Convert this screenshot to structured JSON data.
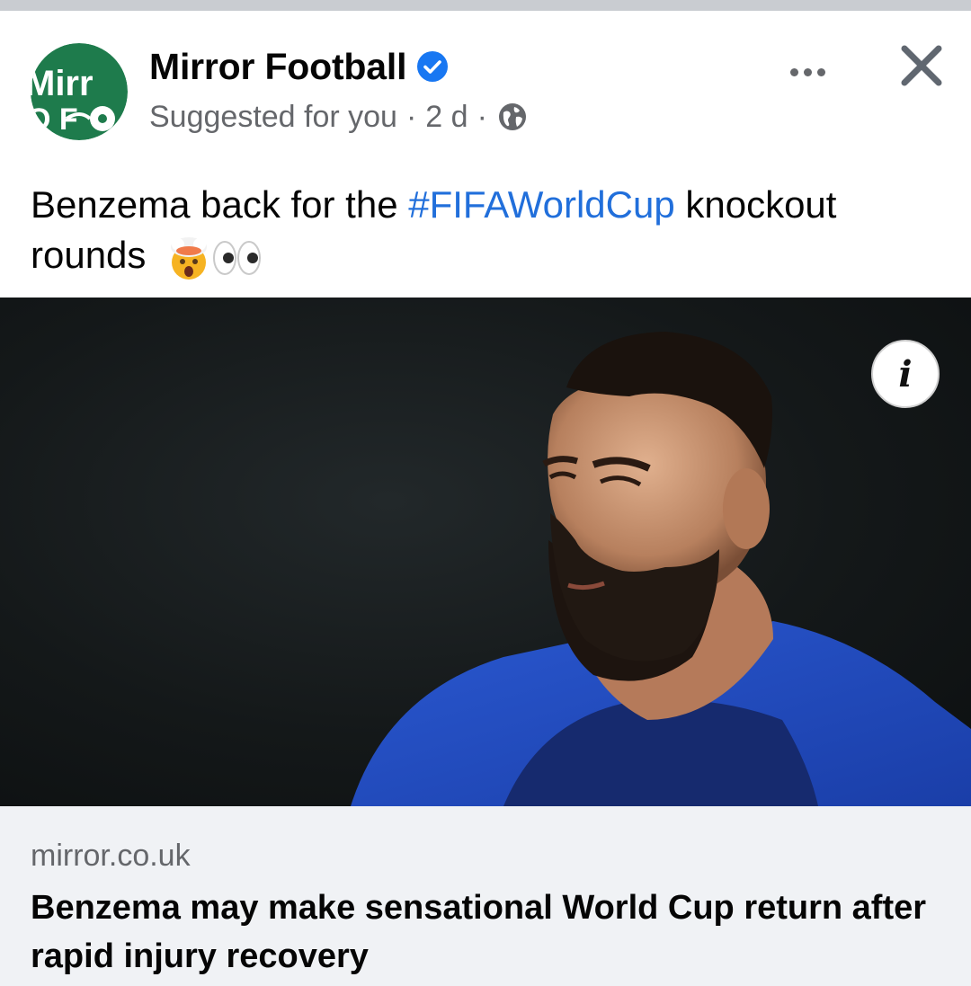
{
  "post": {
    "page_name": "Mirror Football",
    "verified_icon": "verified-badge-icon",
    "subtitle": "Suggested for you",
    "separator": "·",
    "time": "2 d",
    "audience_icon": "globe-icon",
    "more_icon": "more-options-icon",
    "close_icon": "close-icon",
    "avatar_logo_text": "Mirror",
    "caption": {
      "before": "Benzema back for the",
      "hashtag": "#FIFAWorldCup",
      "after": "knockout rounds",
      "emojis": [
        "exploding-head-emoji",
        "eyes-emoji"
      ]
    },
    "image": {
      "description_icon": "info-icon",
      "info_label": "i"
    },
    "link": {
      "domain": "mirror.co.uk",
      "title": "Benzema may make sensational World Cup return after rapid injury recovery"
    }
  },
  "colors": {
    "hashtag": "#216fdb",
    "verified": "#1877f2",
    "avatar_bg": "#1e7b4c",
    "jersey": "#1f46b8"
  }
}
